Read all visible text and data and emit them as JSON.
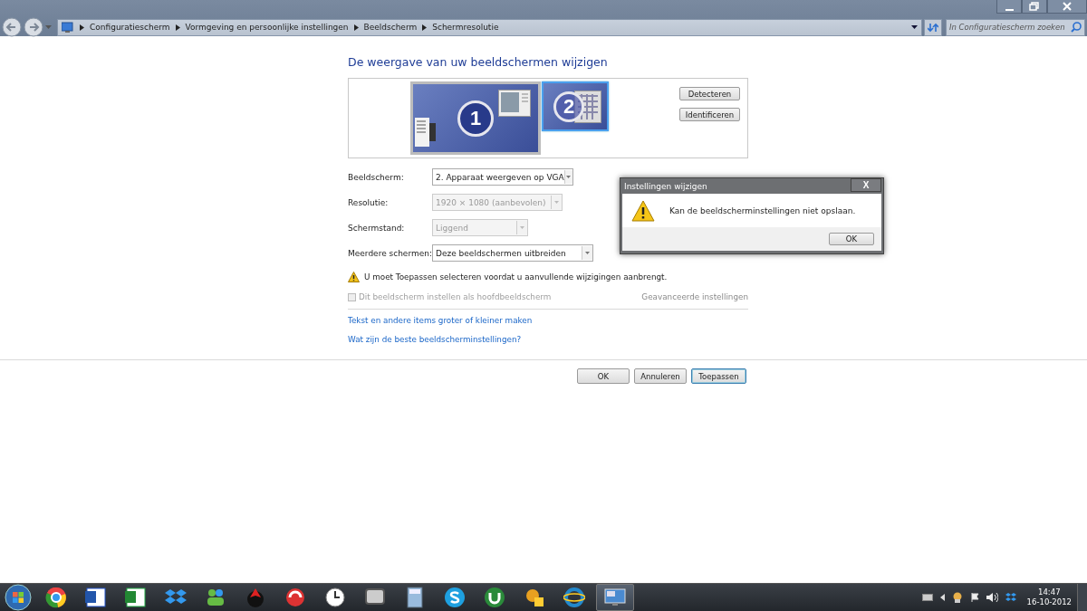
{
  "window": {
    "breadcrumb": [
      "Configuratiescherm",
      "Vormgeving en persoonlijke instellingen",
      "Beeldscherm",
      "Schermresolutie"
    ],
    "search": {
      "placeholder": "In Configuratiescherm zoeken"
    }
  },
  "page": {
    "heading": "De weergave van uw beeldschermen wijzigen",
    "monitors": [
      {
        "label": "1",
        "selected": false
      },
      {
        "label": "2",
        "selected": true
      }
    ],
    "side_buttons": [
      "Detecteren",
      "Identificeren"
    ],
    "fields": [
      {
        "label": "Beeldscherm:",
        "value": "2. Apparaat weergeven op VGA",
        "disabled": false
      },
      {
        "label": "Resolutie:",
        "value": "1920 × 1080 (aanbevolen)",
        "disabled": true
      },
      {
        "label": "Schermstand:",
        "value": "Liggend",
        "disabled": true
      },
      {
        "label": "Meerdere schermen:",
        "value": "Deze beeldschermen uitbreiden",
        "disabled": false
      }
    ],
    "warning": "U moet Toepassen selecteren voordat u aanvullende wijzigingen aanbrengt.",
    "primary_checkbox": {
      "label": "Dit beeldscherm instellen als hoofdbeeldscherm",
      "checked": false,
      "disabled": true
    },
    "advanced_link": {
      "label": "Geavanceerde instellingen",
      "disabled": true
    },
    "links": [
      "Tekst en andere items groter of kleiner maken",
      "Wat zijn de beste beeldscherminstellingen?"
    ],
    "buttons": [
      "OK",
      "Annuleren",
      "Toepassen"
    ]
  },
  "dialog": {
    "title": "Instellingen wijzigen",
    "close": "X",
    "message": "Kan de beeldscherminstellingen niet opslaan.",
    "button": "OK"
  },
  "taskbar": {
    "apps": [
      {
        "active": false
      },
      {
        "active": false
      },
      {
        "active": false
      },
      {
        "active": false
      },
      {
        "active": false
      },
      {
        "active": false
      },
      {
        "active": false
      },
      {
        "active": false
      },
      {
        "active": false
      },
      {
        "active": false
      },
      {
        "active": false
      },
      {
        "active": false
      },
      {
        "active": false
      },
      {
        "active": false
      },
      {
        "active": true
      }
    ],
    "time": "14:47",
    "date": "16-10-2012"
  }
}
